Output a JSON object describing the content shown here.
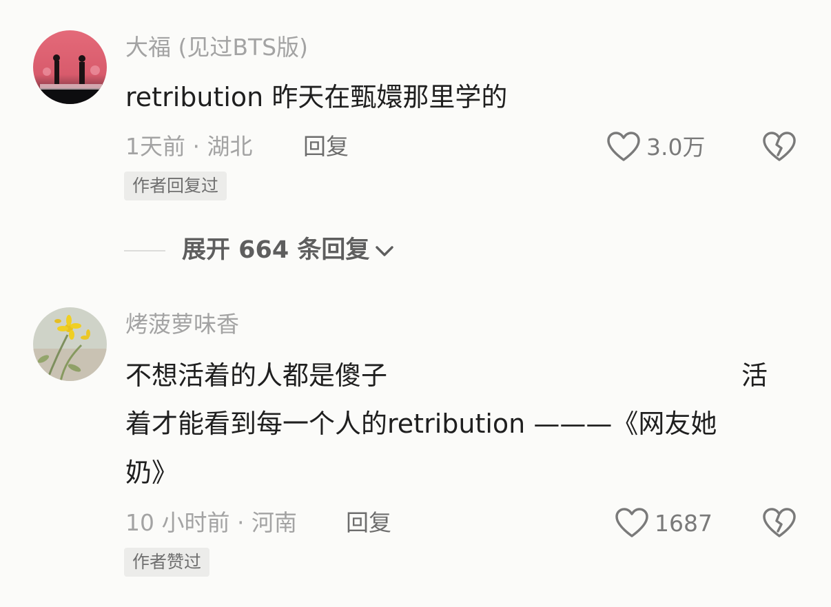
{
  "comments": [
    {
      "username": "大福 (见过BTS版)",
      "lines": [
        "retribution  昨天在甄嬛那里学的"
      ],
      "time_location": "1天前 · 湖北",
      "reply_label": "回复",
      "likes": "3.0万",
      "badge": "作者回复过"
    },
    {
      "username": "烤菠萝味香",
      "lines": [
        "不想活着的人都是傻子",
        "活",
        "着才能看到每一个人的retribution ———《网友她",
        "奶》"
      ],
      "time_location": "10 小时前 · 河南",
      "reply_label": "回复",
      "likes": "1687",
      "badge": "作者赞过"
    }
  ],
  "expand_replies": {
    "label": "展开 664 条回复"
  },
  "icons": {
    "like": "heart-outline-icon",
    "dislike": "broken-heart-icon",
    "expand": "chevron-down-icon"
  },
  "colors": {
    "background": "#fbfbf9",
    "muted_text": "#a3a3a3",
    "badge_bg": "#ececea"
  }
}
